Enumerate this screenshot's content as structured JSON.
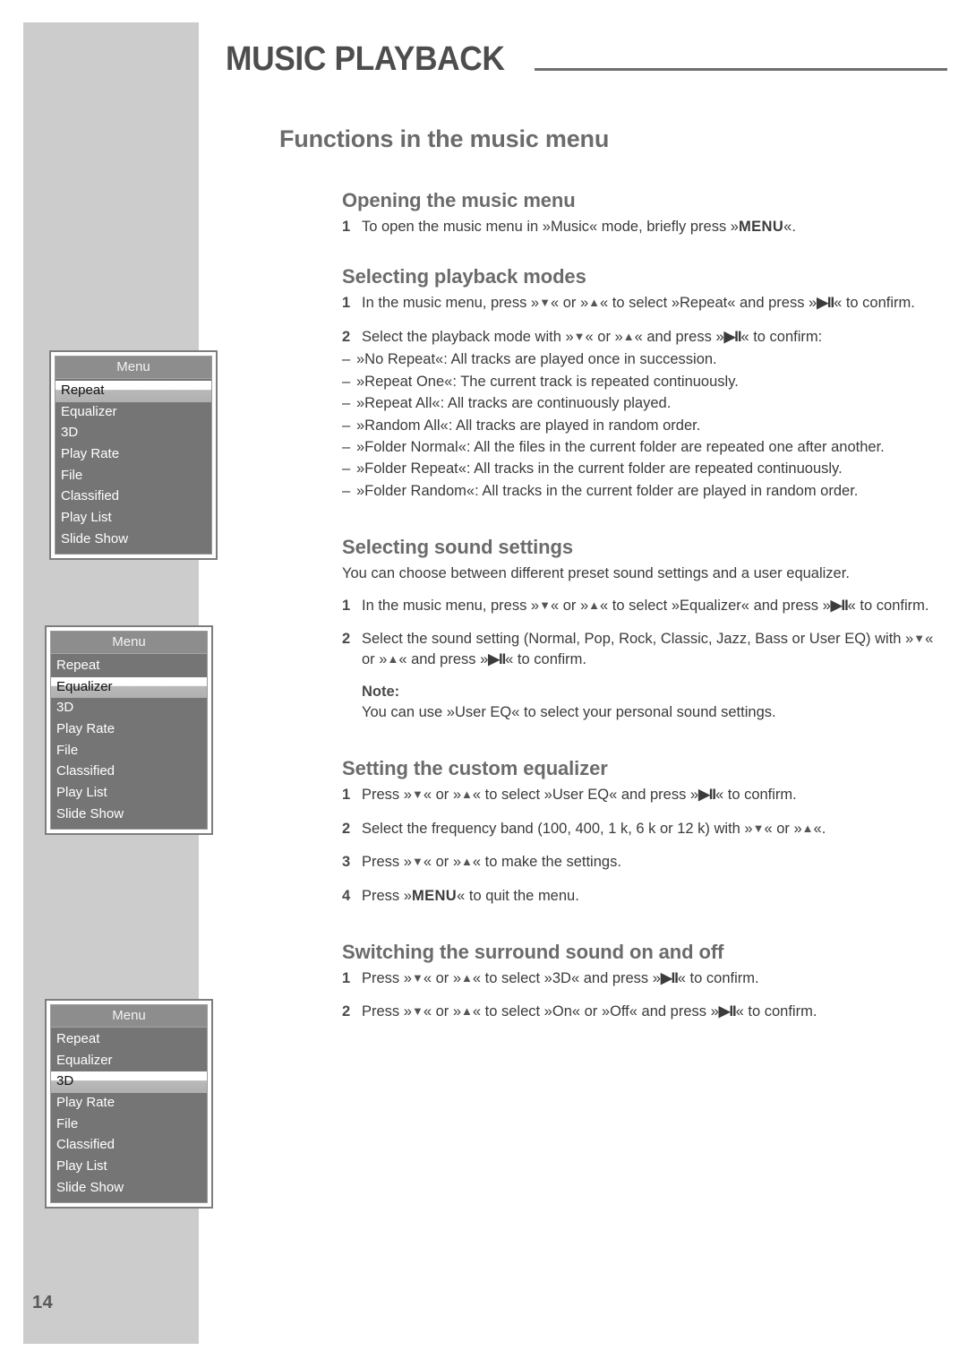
{
  "page": {
    "number": "14",
    "chapter_title": "MUSIC PLAYBACK",
    "title": "Functions in the music menu"
  },
  "sections": [
    {
      "heading": "Opening the music menu",
      "steps": [
        {
          "num": "1",
          "text": "To open the music menu in »Music« mode, briefly press »MENU«."
        }
      ]
    },
    {
      "heading": "Selecting playback modes",
      "steps": [
        {
          "num": "1",
          "text": "In the music menu, press »▼« or »▲« to select »Repeat« and press »▶II« to confirm."
        },
        {
          "num": "2",
          "text": "Select the playback mode with »▼« or »▲« and press »▶II« to confirm:"
        }
      ],
      "modes": [
        "»No Repeat«: All tracks are played once in succession.",
        "»Repeat One«: The current track is repeated continuously.",
        "»Repeat All«: All tracks are continuously played.",
        "»Random All«: All tracks are played in random order.",
        "»Folder Normal«: All the files in the current folder are repeated one after another.",
        "»Folder Repeat«: All tracks in the current folder are repeated continuously.",
        "»Folder Random«: All tracks in the current folder are played in random order."
      ]
    },
    {
      "heading": "Selecting sound settings",
      "intro": "You can choose between different preset sound settings and a user equalizer.",
      "steps": [
        {
          "num": "1",
          "text": "In the music menu, press »▼« or »▲« to select »Equalizer« and press »▶II« to confirm."
        },
        {
          "num": "2",
          "text": "Select the sound setting (Normal, Pop, Rock, Classic, Jazz, Bass or User EQ) with »▼« or »▲« and press »▶II« to confirm."
        }
      ],
      "note": {
        "label": "Note:",
        "text": "You can use »User EQ« to select your personal sound settings."
      }
    },
    {
      "heading": "Setting the custom equalizer",
      "steps": [
        {
          "num": "1",
          "text": "Press »▼« or »▲« to select »User EQ« and press »▶II« to confirm."
        },
        {
          "num": "2",
          "text": "Select the frequency band (100, 400, 1 k, 6 k or 12 k) with »▼« or »▲«."
        },
        {
          "num": "3",
          "text": "Press »▼« or »▲« to make the settings."
        },
        {
          "num": "4",
          "text": "Press »MENU« to quit the menu."
        }
      ]
    },
    {
      "heading": "Switching the surround sound on and off",
      "steps": [
        {
          "num": "1",
          "text": "Press »▼« or »▲« to select »3D« and press »▶II« to confirm."
        },
        {
          "num": "2",
          "text": "Press »▼« or »▲« to select »On« or »Off« and press »▶II« to confirm."
        }
      ]
    }
  ],
  "device_menus": [
    {
      "title": "Menu",
      "selected": "Repeat",
      "items": [
        "Repeat",
        "Equalizer",
        "3D",
        "Play Rate",
        "File",
        "Classified",
        "Play List",
        "Slide Show"
      ]
    },
    {
      "title": "Menu",
      "selected": "Equalizer",
      "items": [
        "Repeat",
        "Equalizer",
        "3D",
        "Play Rate",
        "File",
        "Classified",
        "Play List",
        "Slide Show"
      ]
    },
    {
      "title": "Menu",
      "selected": "3D",
      "items": [
        "Repeat",
        "Equalizer",
        "3D",
        "Play Rate",
        "File",
        "Classified",
        "Play List",
        "Slide Show"
      ]
    }
  ],
  "colors": {
    "band": "#cccccc",
    "heading": "#6b6b6b",
    "body_text": "#3b3b3b",
    "menu_body": "#757575",
    "menu_title_bar": "#8d8d8d"
  }
}
